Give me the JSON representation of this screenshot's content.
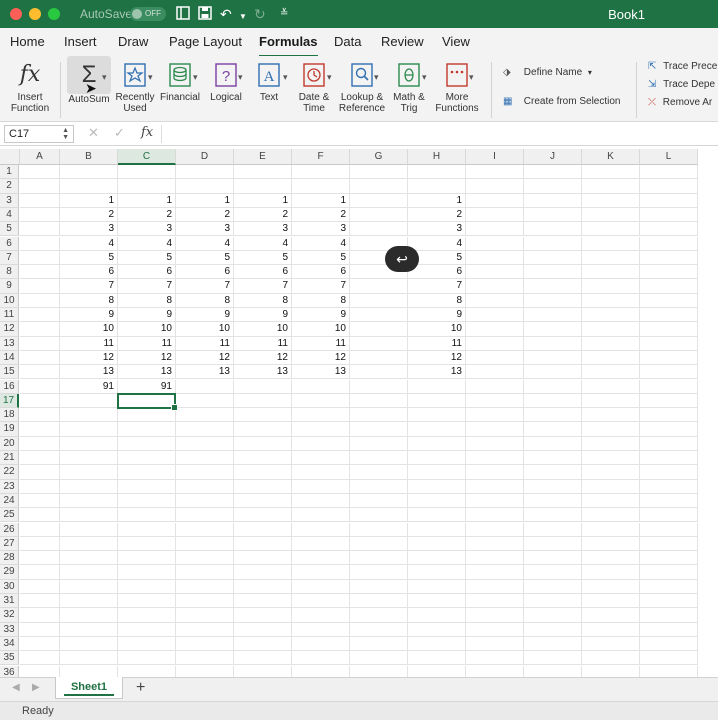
{
  "titlebar": {
    "autosave_label": "AutoSave",
    "autosave_state": "OFF",
    "title": "Book1"
  },
  "menu": {
    "tabs": [
      "Home",
      "Insert",
      "Draw",
      "Page Layout",
      "Formulas",
      "Data",
      "Review",
      "View"
    ],
    "active": "Formulas"
  },
  "ribbon": {
    "insert_function": [
      "Insert",
      "Function"
    ],
    "autosum": [
      "AutoSum",
      ""
    ],
    "recently_used": [
      "Recently",
      "Used"
    ],
    "financial": [
      "Financial",
      ""
    ],
    "logical": [
      "Logical",
      ""
    ],
    "text": [
      "Text",
      ""
    ],
    "date_time": [
      "Date &",
      "Time"
    ],
    "lookup": [
      "Lookup &",
      "Reference"
    ],
    "math": [
      "Math &",
      "Trig"
    ],
    "more": [
      "More",
      "Functions"
    ],
    "define_name": "Define Name",
    "create_from_selection": "Create from Selection",
    "trace_precedents": "Trace Prece",
    "trace_dependents": "Trace Depe",
    "remove_arrows": "Remove Ar"
  },
  "formula_bar": {
    "name_box": "C17",
    "fx": "fx",
    "content": ""
  },
  "grid": {
    "columns": [
      "A",
      "B",
      "C",
      "D",
      "E",
      "F",
      "G",
      "H",
      "I",
      "J",
      "K",
      "L"
    ],
    "selected_column": "C",
    "row_count": 36,
    "selected_row": 17,
    "cells": {
      "B": [
        "",
        "",
        "1",
        "2",
        "3",
        "4",
        "5",
        "6",
        "7",
        "8",
        "9",
        "10",
        "11",
        "12",
        "13",
        "91"
      ],
      "C": [
        "",
        "",
        "1",
        "2",
        "3",
        "4",
        "5",
        "6",
        "7",
        "8",
        "9",
        "10",
        "11",
        "12",
        "13",
        "91"
      ],
      "D": [
        "",
        "",
        "1",
        "2",
        "3",
        "4",
        "5",
        "6",
        "7",
        "8",
        "9",
        "10",
        "11",
        "12",
        "13"
      ],
      "E": [
        "",
        "",
        "1",
        "2",
        "3",
        "4",
        "5",
        "6",
        "7",
        "8",
        "9",
        "10",
        "11",
        "12",
        "13"
      ],
      "F": [
        "",
        "",
        "1",
        "2",
        "3",
        "4",
        "5",
        "6",
        "7",
        "8",
        "9",
        "10",
        "11",
        "12",
        "13"
      ],
      "H": [
        "",
        "",
        "1",
        "2",
        "3",
        "4",
        "5",
        "6",
        "7",
        "8",
        "9",
        "10",
        "11",
        "12",
        "13"
      ]
    },
    "enter_glyph": "↩"
  },
  "sheets": {
    "tabs": [
      "Sheet1"
    ],
    "add": "+"
  },
  "status": {
    "text": "Ready"
  },
  "colors": {
    "accent": "#1f7244"
  }
}
